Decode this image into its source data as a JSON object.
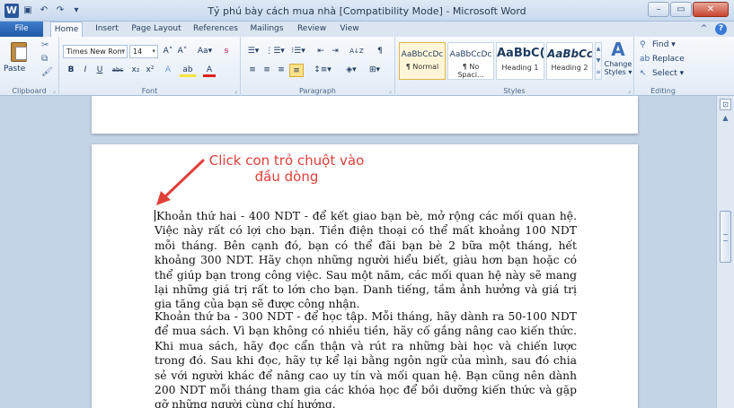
{
  "window": {
    "title": "Tỷ phú bày cách mua nhà [Compatibility Mode] - Microsoft Word",
    "app_logo": "W",
    "controls": {
      "minimize": "–",
      "maximize": "▭",
      "close": "✕"
    }
  },
  "qat": {
    "save": "▣",
    "undo": "↶",
    "redo": "↷",
    "customize": "▾"
  },
  "tabs": [
    "File",
    "Home",
    "Insert",
    "Page Layout",
    "References",
    "Mailings",
    "Review",
    "View"
  ],
  "active_tab": "Home",
  "help": {
    "minimize_ribbon": "^",
    "help": "?"
  },
  "ribbon": {
    "clipboard": {
      "label": "Clipboard",
      "paste": "Paste",
      "cut": "✂",
      "copy": "⧉",
      "format_painter": "🖌"
    },
    "font": {
      "label": "Font",
      "font_name": "Times New Rom",
      "font_size": "14",
      "grow": "A˄",
      "shrink": "A˅",
      "change_case": "Aa▾",
      "clear_format": "ꞩ",
      "bold": "B",
      "italic": "I",
      "underline": "U",
      "strike": "abc",
      "subscript": "x₂",
      "superscript": "x²",
      "text_effects": "A",
      "highlight": "ab",
      "font_color": "A"
    },
    "paragraph": {
      "label": "Paragraph",
      "bullets": "☰▾",
      "numbering": "⋮☰▾",
      "multilevel": "⁝☰▾",
      "decrease_indent": "⇤",
      "increase_indent": "⇥",
      "sort": "A↓Z",
      "show_marks": "¶",
      "align_left": "≡",
      "align_center": "≡",
      "align_right": "≡",
      "justify": "≡",
      "line_spacing": "↕≡▾",
      "shading": "◈▾",
      "borders": "⊞▾"
    },
    "styles": {
      "label": "Styles",
      "items": [
        {
          "sample": "AaBbCcDc",
          "name": "¶ Normal"
        },
        {
          "sample": "AaBbCcDc",
          "name": "¶ No Spaci..."
        },
        {
          "sample": "AaBbC(",
          "name": "Heading 1"
        },
        {
          "sample": "AaBbCc",
          "name": "Heading 2"
        }
      ],
      "change_styles": "Change Styles ▾"
    },
    "editing": {
      "label": "Editing",
      "find": "Find ▾",
      "replace": "Replace",
      "select": "Select ▾"
    }
  },
  "annotation": {
    "line1": "Click con trỏ chuột vào",
    "line2": "đầu dòng",
    "color": "#e0403a"
  },
  "document": {
    "paragraphs": [
      "Khoản thứ hai - 400 NDT - để kết giao bạn bè, mở rộng các mối quan hệ. Việc này rất có lợi cho bạn. Tiền điện thoại có thể mất khoảng 100 NDT mỗi tháng. Bên cạnh đó, bạn có thể đãi bạn bè 2 bữa một tháng, hết khoảng 300 NDT. Hãy chọn những người hiểu biết, giàu hơn bạn hoặc có thể giúp bạn trong công việc. Sau một năm, các mối quan hệ này sẽ mang lại những giá trị rất to lớn cho bạn. Danh tiếng, tầm ảnh hưởng và giá trị gia tăng của bạn sẽ được công nhận.",
      "Khoản thứ ba - 300 NDT - để học tập. Mỗi tháng, hãy dành ra 50-100 NDT để mua sách. Vì bạn không có nhiều tiền, hãy cố gắng nâng cao kiến thức. Khi mua sách, hãy đọc cẩn thận và rút ra những bài học và chiến lược trong đó. Sau khi đọc, hãy tự kể lại bằng ngôn ngữ của mình, sau đó chia sẻ với người khác để nâng cao uy tín và mối quan hệ. Bạn cũng nên dành 200 NDT mỗi tháng tham gia các khóa học để bồi dưỡng kiến thức và gặp gỡ những người cùng chí hướng."
    ]
  }
}
